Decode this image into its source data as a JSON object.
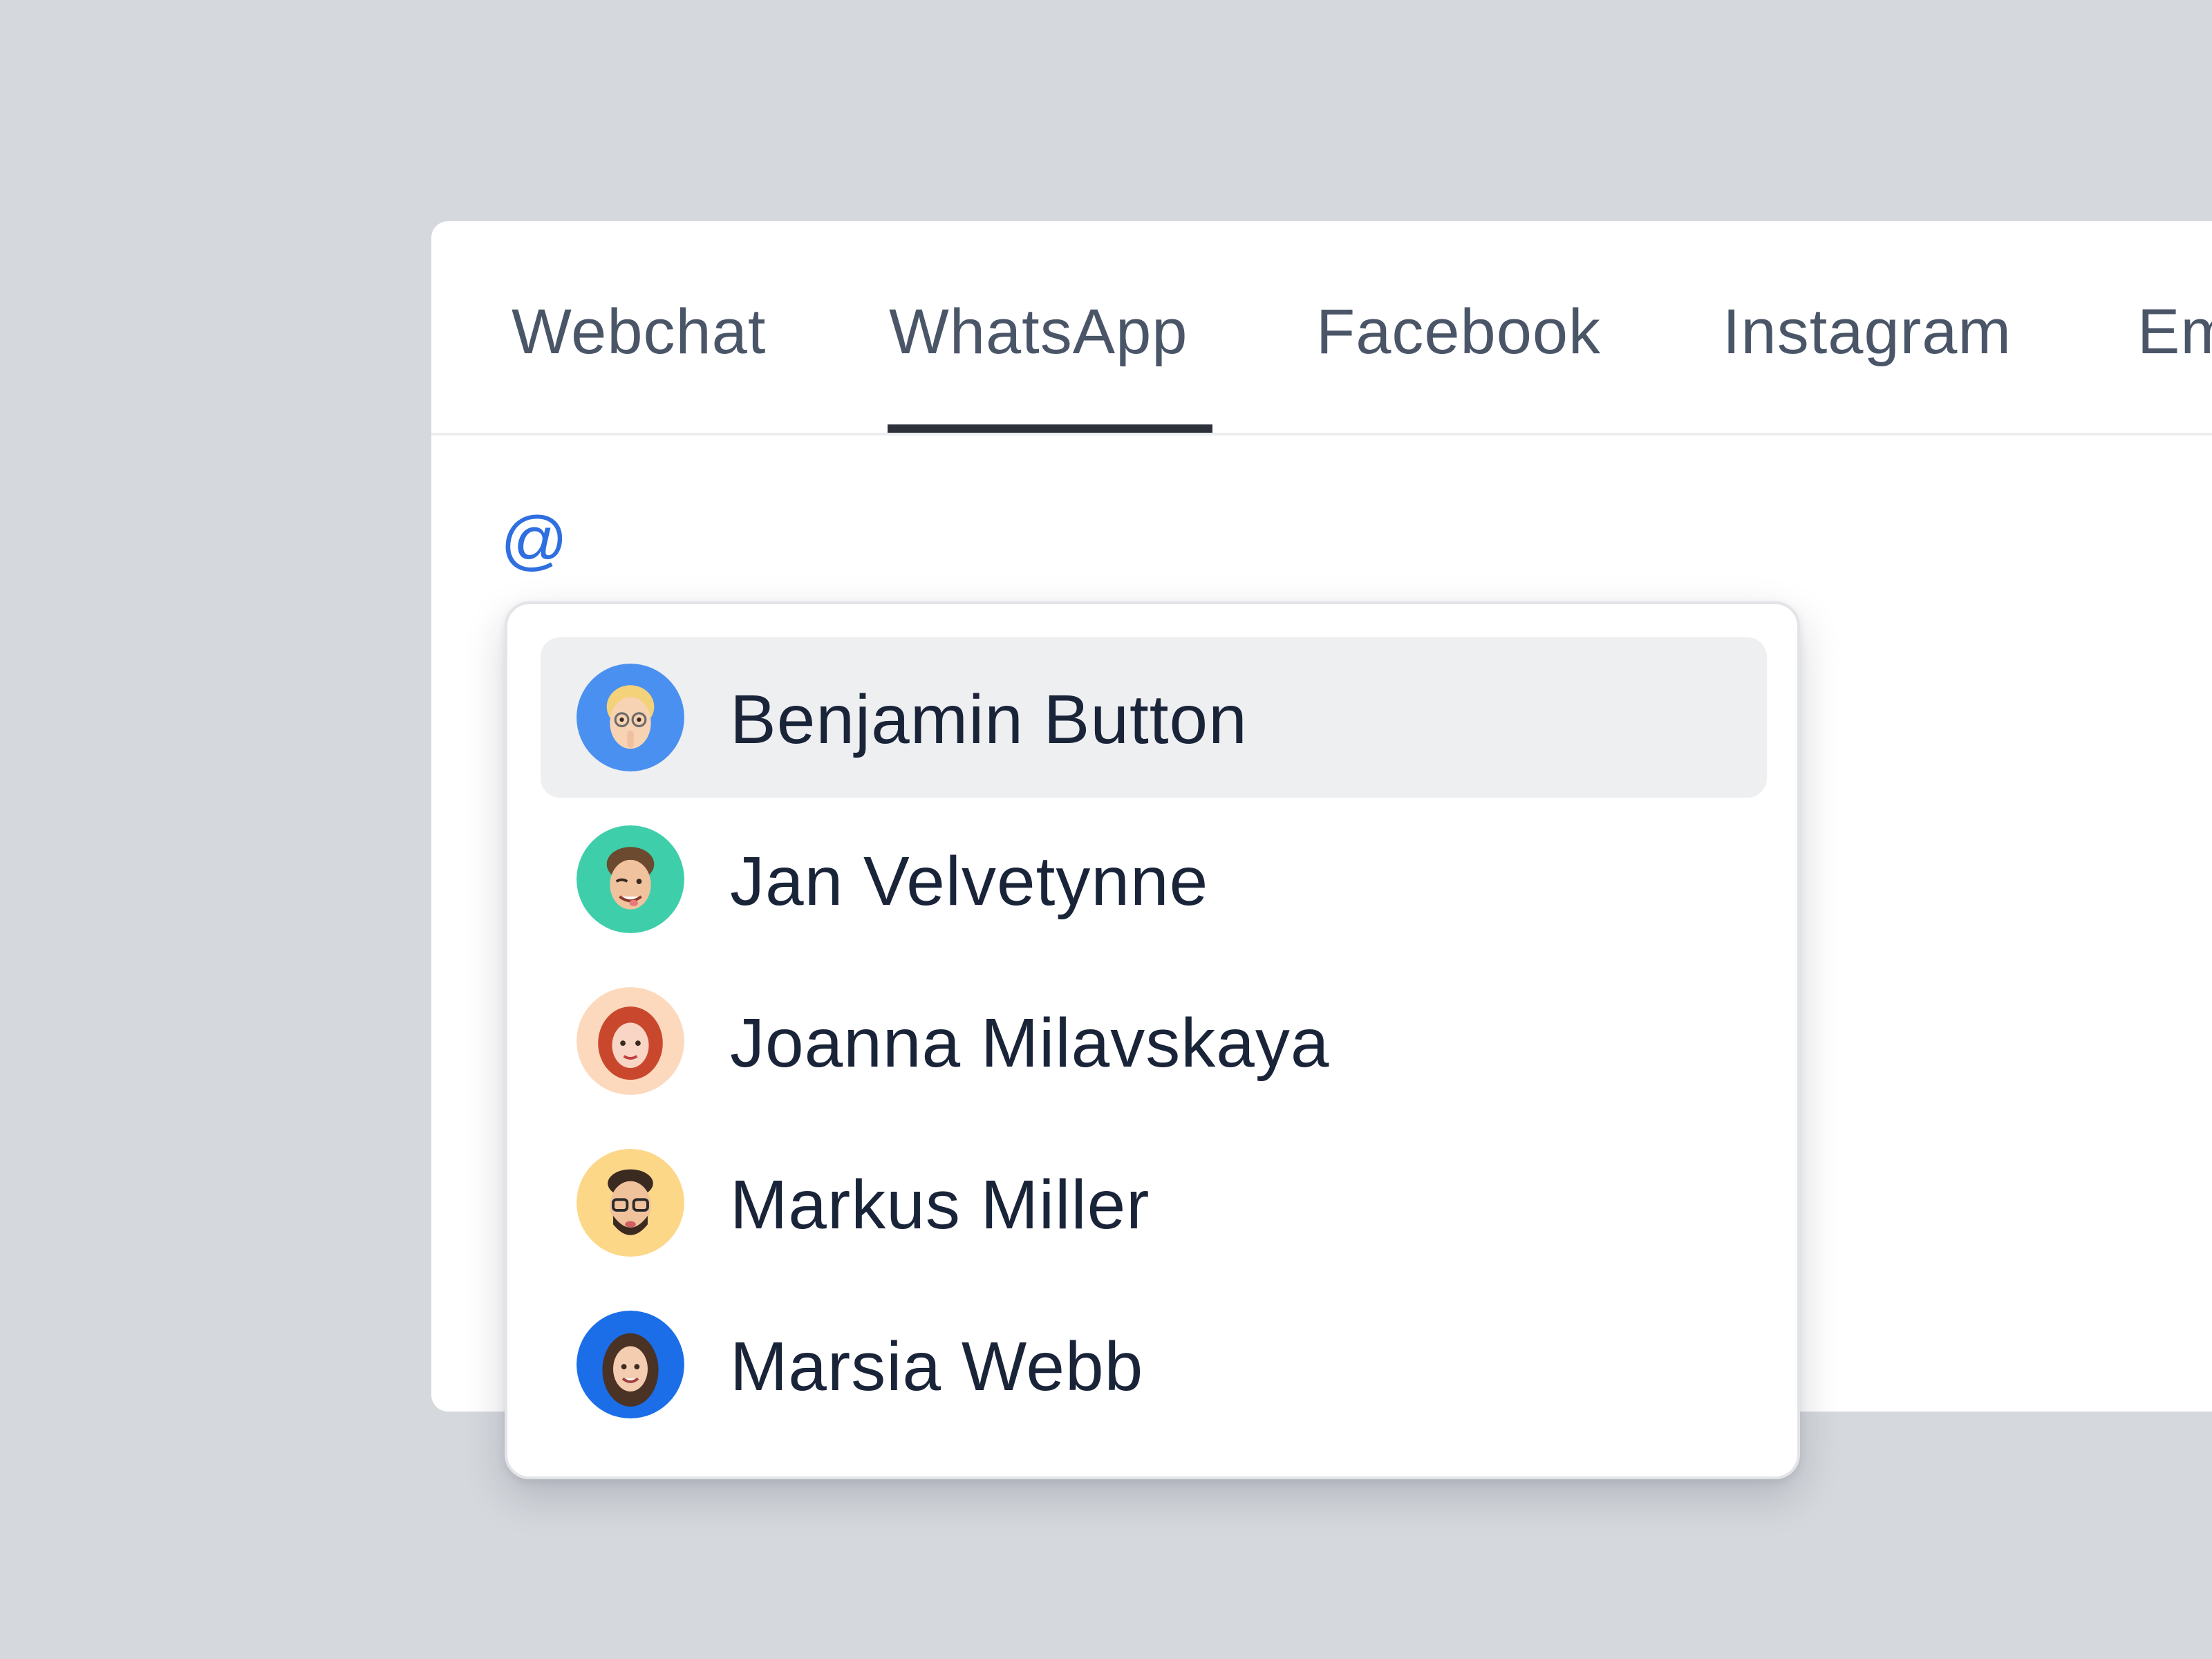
{
  "tabs": [
    {
      "label": "Webchat",
      "active": false
    },
    {
      "label": "WhatsApp",
      "active": true
    },
    {
      "label": "Facebook",
      "active": false
    },
    {
      "label": "Instagram",
      "active": false
    },
    {
      "label": "Em",
      "active": false
    }
  ],
  "composer": {
    "text": "@"
  },
  "mention_list": {
    "highlighted_index": 0,
    "items": [
      {
        "name": "Benjamin Button",
        "avatar_bg": "#4a90f0",
        "hair": "#f3d27a",
        "skin": "#f7d2b3"
      },
      {
        "name": "Jan Velvetynne",
        "avatar_bg": "#3ecfaa",
        "hair": "#6b4a2f",
        "skin": "#f1c29e"
      },
      {
        "name": "Joanna Milavskaya",
        "avatar_bg": "#fcd9bd",
        "hair": "#c9482d",
        "skin": "#f8d5c4"
      },
      {
        "name": "Markus Miller",
        "avatar_bg": "#fdd788",
        "hair": "#3a2a1f",
        "skin": "#f0c29c"
      },
      {
        "name": "Marsia Webb",
        "avatar_bg": "#1b6ee8",
        "hair": "#4a3225",
        "skin": "#f4cdb0"
      }
    ]
  },
  "colors": {
    "background": "#d5d8dd",
    "accent": "#2f6fe0",
    "active_tab_underline": "#2c313a"
  }
}
